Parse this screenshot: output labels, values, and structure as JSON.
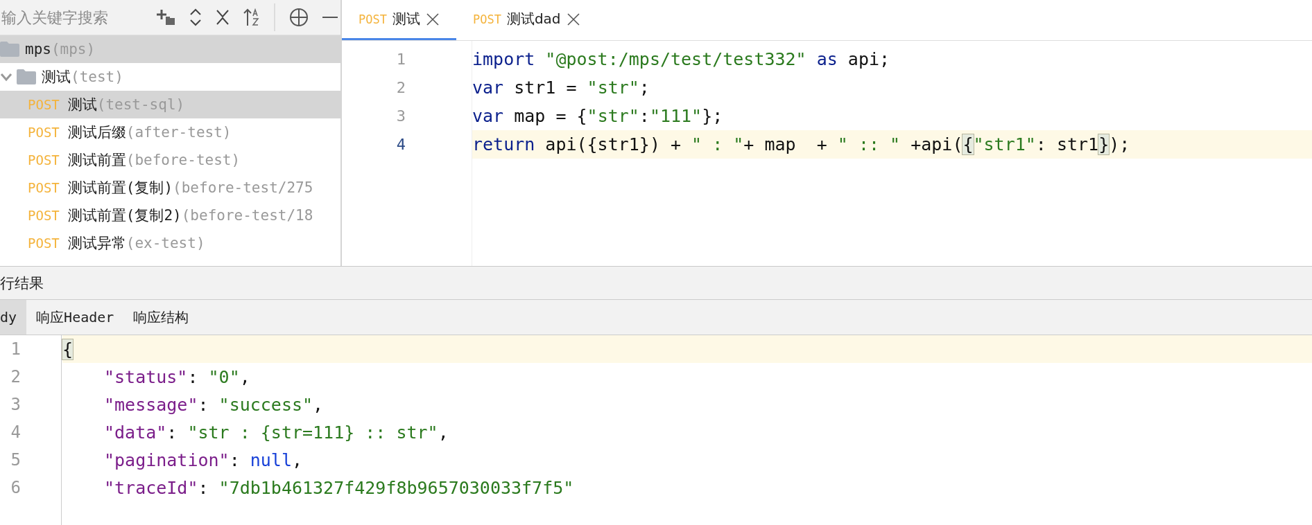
{
  "sidebar": {
    "search": {
      "placeholder": "输入关键字搜索"
    },
    "tree": [
      {
        "label": "mps",
        "sub": "(mps)",
        "selected": true,
        "children": [
          {
            "label": "测试",
            "sub": "(test)",
            "selected": false,
            "expanded": true,
            "children": [
              {
                "method": "POST",
                "label": "测试",
                "sub": "(test-sql)",
                "selected": true
              },
              {
                "method": "POST",
                "label": "测试后缀",
                "sub": "(after-test)",
                "selected": false
              },
              {
                "method": "POST",
                "label": "测试前置",
                "sub": "(before-test)",
                "selected": false
              },
              {
                "method": "POST",
                "label": "测试前置(复制)",
                "sub": "(before-test/275",
                "selected": false
              },
              {
                "method": "POST",
                "label": "测试前置(复制2)",
                "sub": "(before-test/18",
                "selected": false
              },
              {
                "method": "POST",
                "label": "测试异常",
                "sub": "(ex-test)",
                "selected": false
              }
            ]
          }
        ]
      }
    ]
  },
  "editor_tabs": [
    {
      "method": "POST",
      "label": "测试",
      "selected": true
    },
    {
      "method": "POST",
      "label": "测试dad",
      "selected": false
    }
  ],
  "editor": {
    "lines": [
      {
        "number": "1",
        "current": false,
        "tokens": [
          {
            "kind": "keyword",
            "text": "import"
          },
          {
            "kind": "string",
            "text": " \"@post:/mps/test/test332\" "
          },
          {
            "kind": "keyword",
            "text": "as"
          },
          {
            "kind": "plain",
            "text": " api;"
          }
        ]
      },
      {
        "number": "2",
        "current": false,
        "tokens": [
          {
            "kind": "keyword",
            "text": "var"
          },
          {
            "kind": "plain",
            "text": " str1 = "
          },
          {
            "kind": "string",
            "text": "\"str\""
          },
          {
            "kind": "plain",
            "text": ";"
          }
        ]
      },
      {
        "number": "3",
        "current": false,
        "tokens": [
          {
            "kind": "keyword",
            "text": "var"
          },
          {
            "kind": "plain",
            "text": " map = {"
          },
          {
            "kind": "string",
            "text": "\"str\""
          },
          {
            "kind": "plain",
            "text": ":"
          },
          {
            "kind": "string",
            "text": "\"111\""
          },
          {
            "kind": "plain",
            "text": "};"
          }
        ]
      },
      {
        "number": "4",
        "current": true,
        "tokens": [
          {
            "kind": "keyword",
            "text": "return"
          },
          {
            "kind": "plain",
            "text": " api({str1}) + "
          },
          {
            "kind": "string",
            "text": "\" : \""
          },
          {
            "kind": "plain",
            "text": "+ map  + "
          },
          {
            "kind": "string",
            "text": "\" :: \""
          },
          {
            "kind": "plain",
            "text": " +api("
          },
          {
            "kind": "match",
            "text": "{"
          },
          {
            "kind": "string",
            "text": "\"str1\""
          },
          {
            "kind": "plain",
            "text": ": str1"
          },
          {
            "kind": "match",
            "text": "}"
          },
          {
            "kind": "plain",
            "text": ");"
          }
        ]
      }
    ]
  },
  "result_panel": {
    "title": "行结果",
    "tabs": [
      {
        "label": "dy",
        "selected": true
      },
      {
        "label": "响应Header",
        "selected": false
      },
      {
        "label": "响应结构",
        "selected": false
      }
    ],
    "lines": [
      {
        "number": "1",
        "current": true,
        "indent": false,
        "tokens": [
          {
            "kind": "match",
            "text": "{"
          }
        ]
      },
      {
        "number": "2",
        "current": false,
        "indent": true,
        "tokens": [
          {
            "kind": "property",
            "text": "\"status\""
          },
          {
            "kind": "plain",
            "text": ": "
          },
          {
            "kind": "string",
            "text": "\"0\""
          },
          {
            "kind": "plain",
            "text": ","
          }
        ]
      },
      {
        "number": "3",
        "current": false,
        "indent": true,
        "tokens": [
          {
            "kind": "property",
            "text": "\"message\""
          },
          {
            "kind": "plain",
            "text": ": "
          },
          {
            "kind": "string",
            "text": "\"success\""
          },
          {
            "kind": "plain",
            "text": ","
          }
        ]
      },
      {
        "number": "4",
        "current": false,
        "indent": true,
        "tokens": [
          {
            "kind": "property",
            "text": "\"data\""
          },
          {
            "kind": "plain",
            "text": ": "
          },
          {
            "kind": "string",
            "text": "\"str : {str=111} :: str\""
          },
          {
            "kind": "plain",
            "text": ","
          }
        ]
      },
      {
        "number": "5",
        "current": false,
        "indent": true,
        "tokens": [
          {
            "kind": "property",
            "text": "\"pagination\""
          },
          {
            "kind": "plain",
            "text": ": "
          },
          {
            "kind": "null",
            "text": "null"
          },
          {
            "kind": "plain",
            "text": ","
          }
        ]
      },
      {
        "number": "6",
        "current": false,
        "indent": true,
        "tokens": [
          {
            "kind": "property",
            "text": "\"traceId\""
          },
          {
            "kind": "plain",
            "text": ": "
          },
          {
            "kind": "string",
            "text": "\"7db1b461327f429f8b9657030033f7f5\""
          }
        ]
      }
    ]
  }
}
